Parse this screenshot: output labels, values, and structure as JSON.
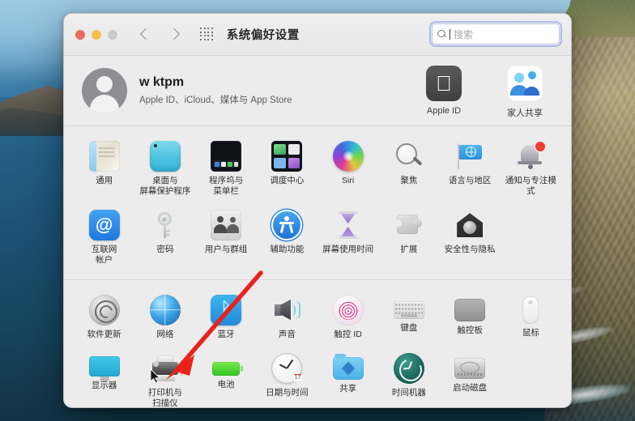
{
  "window": {
    "title": "系统偏好设置",
    "traffic_lights": [
      "close",
      "minimize",
      "zoom"
    ],
    "nav": {
      "back": "‹",
      "forward": "›",
      "show_all": "show-all-grid"
    }
  },
  "search": {
    "placeholder": "搜索",
    "value": "",
    "focused": true,
    "icon": "search-icon",
    "focus_ring_color": "#7096e6"
  },
  "account": {
    "name": "w ktpm",
    "subtitle": "Apple ID、iCloud、媒体与 App Store",
    "avatar_icon": "person-avatar-icon"
  },
  "account_actions": [
    {
      "label": "Apple ID",
      "icon": "apple-logo-icon",
      "glyph": ""
    },
    {
      "label": "家人共享",
      "icon": "family-sharing-icon"
    }
  ],
  "sections": [
    {
      "name": "personal",
      "items": [
        {
          "label": "通用",
          "icon": "general-icon",
          "art": "ic-general"
        },
        {
          "label": "桌面与\n屏幕保护程序",
          "icon": "desktop-screensaver-icon",
          "art": "ic-desktop"
        },
        {
          "label": "程序坞与\n菜单栏",
          "icon": "dock-menubar-icon",
          "art": "ic-dock"
        },
        {
          "label": "调度中心",
          "icon": "mission-control-icon",
          "art": "ic-mission"
        },
        {
          "label": "Siri",
          "icon": "siri-icon",
          "art": "ic-siri"
        },
        {
          "label": "聚焦",
          "icon": "spotlight-icon",
          "art": "ic-spotlight"
        },
        {
          "label": "语言与地区",
          "icon": "language-region-icon",
          "art": "ic-lang"
        },
        {
          "label": "通知与专注模式",
          "icon": "notifications-focus-icon",
          "art": "ic-notif"
        },
        {
          "label": "互联网\n帐户",
          "icon": "internet-accounts-icon",
          "art": "ic-internet"
        },
        {
          "label": "密码",
          "icon": "passwords-key-icon",
          "art": "ic-key"
        },
        {
          "label": "用户与群组",
          "icon": "users-groups-icon",
          "art": "ic-users"
        },
        {
          "label": "辅助功能",
          "icon": "accessibility-icon",
          "art": "ic-access"
        },
        {
          "label": "屏幕使用时间",
          "icon": "screen-time-icon",
          "art": "ic-screentime"
        },
        {
          "label": "扩展",
          "icon": "extensions-puzzle-icon",
          "art": "ic-ext"
        },
        {
          "label": "安全性与隐私",
          "icon": "security-privacy-icon",
          "art": "ic-security"
        }
      ]
    },
    {
      "name": "hardware",
      "items": [
        {
          "label": "软件更新",
          "icon": "software-update-icon",
          "art": "ic-update"
        },
        {
          "label": "网络",
          "icon": "network-globe-icon",
          "art": "ic-network"
        },
        {
          "label": "蓝牙",
          "icon": "bluetooth-icon",
          "art": "ic-bt",
          "glyph": "ᛒ"
        },
        {
          "label": "声音",
          "icon": "sound-speaker-icon",
          "art": "ic-sound"
        },
        {
          "label": "触控 ID",
          "icon": "touch-id-icon",
          "art": "ic-touchid"
        },
        {
          "label": "键盘",
          "icon": "keyboard-icon",
          "art": "ic-keyboard"
        },
        {
          "label": "触控板",
          "icon": "trackpad-icon",
          "art": "ic-trackpad"
        },
        {
          "label": "鼠标",
          "icon": "mouse-icon",
          "art": "ic-mouse"
        },
        {
          "label": "显示器",
          "icon": "displays-icon",
          "art": "ic-display"
        },
        {
          "label": "打印机与\n扫描仪",
          "icon": "printers-scanners-icon",
          "art": "ic-printer"
        },
        {
          "label": "电池",
          "icon": "battery-icon",
          "art": "ic-battery"
        },
        {
          "label": "日期与时间",
          "icon": "date-time-clock-icon",
          "art": "ic-clock",
          "clock_date": "17"
        },
        {
          "label": "共享",
          "icon": "sharing-folder-icon",
          "art": "ic-share"
        },
        {
          "label": "时间机器",
          "icon": "time-machine-icon",
          "art": "ic-timemachine"
        },
        {
          "label": "启动磁盘",
          "icon": "startup-disk-icon",
          "art": "ic-disk"
        }
      ]
    }
  ],
  "annotation": {
    "arrow_color": "#e8231d",
    "target_label": "打印机与扫描仪",
    "cursor": "arrow-pointer"
  },
  "desktop": {
    "wallpaper": "big-sur-coastline"
  }
}
